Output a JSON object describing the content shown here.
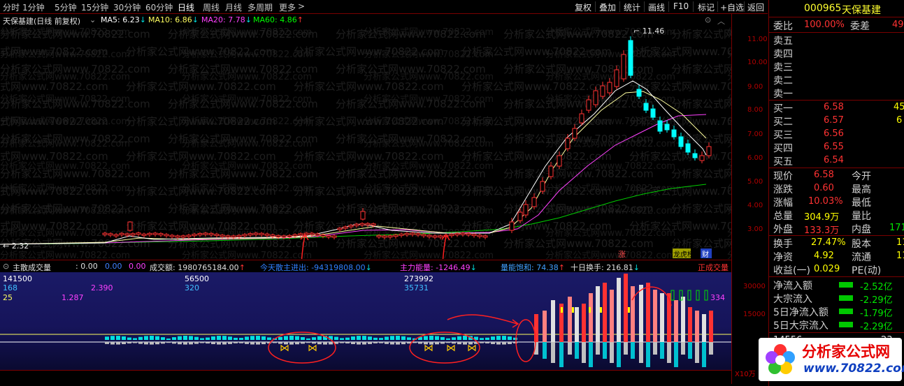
{
  "toolbar": {
    "periods": [
      "分时",
      "1分钟",
      "5分钟",
      "15分钟",
      "30分钟",
      "60分钟",
      "日线",
      "周线",
      "月线",
      "多周期",
      "更多"
    ],
    "active_period": "日线",
    "more_arrow": ">",
    "buttons": [
      "复权",
      "叠加",
      "统计",
      "画线",
      "F10",
      "标记",
      "+自选",
      "返回"
    ]
  },
  "chart": {
    "title": "天保基建(日线 前复权)",
    "ma5": "MA5: 6.23",
    "ma10": "MA10: 6.86",
    "ma20": "MA20: 7.78",
    "ma60": "MA60: 4.86",
    "high_label": "11.46",
    "low_label": "2.32",
    "badges": [
      "涨",
      "龙虎榜",
      "财"
    ],
    "watermark": "分析家公式网www.70822.com",
    "colors": {
      "ma5": "#ffffff",
      "ma10": "#ffff00",
      "ma20": "#ff40ff",
      "ma60": "#00ff00",
      "up": "#ff3232",
      "down": "#00ffff"
    }
  },
  "axis": {
    "price_ticks": [
      "11.00",
      "10.00",
      "9.00",
      "8.00",
      "7.00",
      "6.00",
      "5.00",
      "4.00",
      "3.00"
    ],
    "vol_ticks": [
      "30000",
      "15000"
    ],
    "bottom_tick": "X10万"
  },
  "sub": {
    "title": "主散成交量",
    "v0": ": 0.00",
    "v1": "0.00",
    "v2": "0.00",
    "turnover": "成交额: 1980765184.00",
    "main_fund": "今天散主进出: -94319808.00",
    "energy": "主力能量: -1246.49",
    "saturation": "量能饱和: 74.38",
    "ten_day": "十日换手: 216.81",
    "label_right": "正成交量",
    "left_values": [
      "141500",
      "168",
      "25"
    ],
    "left_values2": [
      "2.390",
      "1.287"
    ],
    "mid_values": [
      "56500",
      "320"
    ],
    "right_values": [
      "273992",
      "35731"
    ],
    "right_num": "334"
  },
  "right_panel": {
    "code": "000965",
    "name": "天保基建",
    "weibi_label": "委比",
    "weibi": "100.00%",
    "weicha_label": "委差",
    "weicha": "49",
    "sells": [
      {
        "label": "卖五",
        "price": "",
        "vol": ""
      },
      {
        "label": "卖四",
        "price": "",
        "vol": ""
      },
      {
        "label": "卖三",
        "price": "",
        "vol": ""
      },
      {
        "label": "卖二",
        "price": "",
        "vol": ""
      },
      {
        "label": "卖一",
        "price": "",
        "vol": ""
      }
    ],
    "buys": [
      {
        "label": "买一",
        "price": "6.58",
        "vol": "45"
      },
      {
        "label": "买二",
        "price": "6.57",
        "vol": "6"
      },
      {
        "label": "买三",
        "price": "6.56",
        "vol": ""
      },
      {
        "label": "买四",
        "price": "6.55",
        "vol": ""
      },
      {
        "label": "买五",
        "price": "6.54",
        "vol": ""
      }
    ],
    "stats": [
      {
        "l": "现价",
        "v": "6.58",
        "l2": "今开",
        "v2": ""
      },
      {
        "l": "涨跌",
        "v": "0.60",
        "l2": "最高",
        "v2": ""
      },
      {
        "l": "涨幅",
        "v": "10.03%",
        "l2": "最低",
        "v2": ""
      },
      {
        "l": "总量",
        "v": "304.9万",
        "l2": "量比",
        "v2": ""
      },
      {
        "l": "外盘",
        "v": "133.3万",
        "l2": "内盘",
        "v2": "171"
      }
    ],
    "stats2": [
      {
        "l": "换手",
        "v": "27.47%",
        "l2": "股本",
        "v2": "11"
      },
      {
        "l": "净资",
        "v": "4.92",
        "l2": "流通",
        "v2": "11"
      },
      {
        "l": "收益(一)",
        "v": "0.029",
        "l2": "PE(动)",
        "v2": ""
      }
    ],
    "flows": [
      {
        "l": "净流入额",
        "v": "-2.52亿"
      },
      {
        "l": "大宗流入",
        "v": "-2.29亿"
      },
      {
        "l": "5日净流入额",
        "v": "-1.79亿"
      },
      {
        "l": "5日大宗流入",
        "v": "-2.29亿"
      }
    ],
    "bottom_left": "14556",
    "bottom_right": "23"
  },
  "logo": {
    "text": "分析家公式网",
    "url": "www.70822.com"
  }
}
